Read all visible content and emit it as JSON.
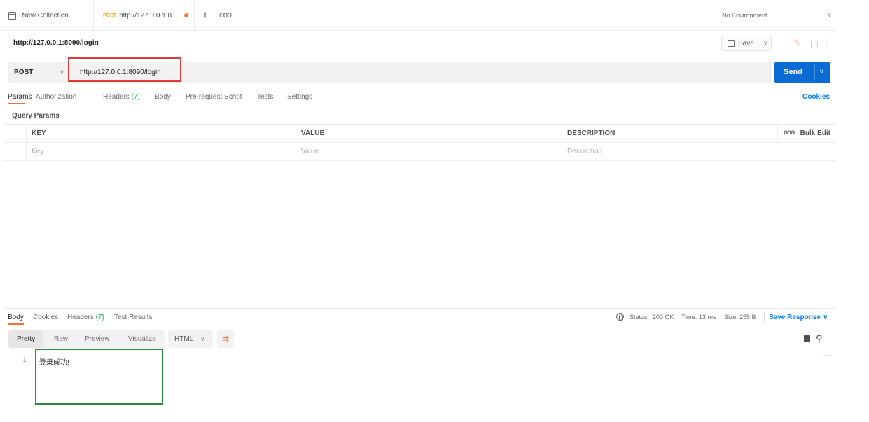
{
  "tabs": [
    {
      "label": "New Collection",
      "type": "collection"
    },
    {
      "method": "POST",
      "label": "http://127.0.0.1:8...",
      "unsaved": true
    }
  ],
  "tabbar": {
    "add_glyph": "+",
    "more_glyph": "ooo"
  },
  "environment": {
    "label": "No Environment",
    "chevron": "∨"
  },
  "request": {
    "name": "http://127.0.0.1:8090/login",
    "save_label": "Save",
    "method": "POST",
    "url": "http://127.0.0.1:8090/login",
    "send_label": "Send"
  },
  "request_tabs": [
    {
      "label": "Params",
      "active": true
    },
    {
      "label": "Authorization"
    },
    {
      "label": "Headers",
      "count": "(7)"
    },
    {
      "label": "Body"
    },
    {
      "label": "Pre-request Script"
    },
    {
      "label": "Tests"
    },
    {
      "label": "Settings"
    }
  ],
  "cookies_link": "Cookies",
  "query_params": {
    "title": "Query Params",
    "headers": [
      "KEY",
      "VALUE",
      "DESCRIPTION"
    ],
    "placeholders": [
      "Key",
      "Value",
      "Description"
    ],
    "more_glyph": "ooo",
    "bulk_edit": "Bulk Edit"
  },
  "response_tabs": [
    {
      "label": "Body",
      "active": true
    },
    {
      "label": "Cookies"
    },
    {
      "label": "Headers",
      "count": "(7)"
    },
    {
      "label": "Test Results"
    }
  ],
  "response_meta": {
    "status_label": "Status:",
    "status_value": "200 OK",
    "time_label": "Time:",
    "time_value": "13 ms",
    "size_label": "Size:",
    "size_value": "255 B",
    "save_response": "Save Response ∨"
  },
  "view_modes": [
    {
      "label": "Pretty",
      "active": true
    },
    {
      "label": "Raw"
    },
    {
      "label": "Preview"
    },
    {
      "label": "Visualize"
    }
  ],
  "format": {
    "label": "HTML",
    "chevron": "∨"
  },
  "response_body": {
    "line_number": "1",
    "text": "登录成功!"
  },
  "colors": {
    "accent_orange": "#ff6c37",
    "send_blue": "#0a6bd4",
    "status_green": "#0cbb52",
    "link_blue": "#097bed",
    "highlight_red": "#e53935",
    "highlight_green": "#2e8b3a"
  }
}
